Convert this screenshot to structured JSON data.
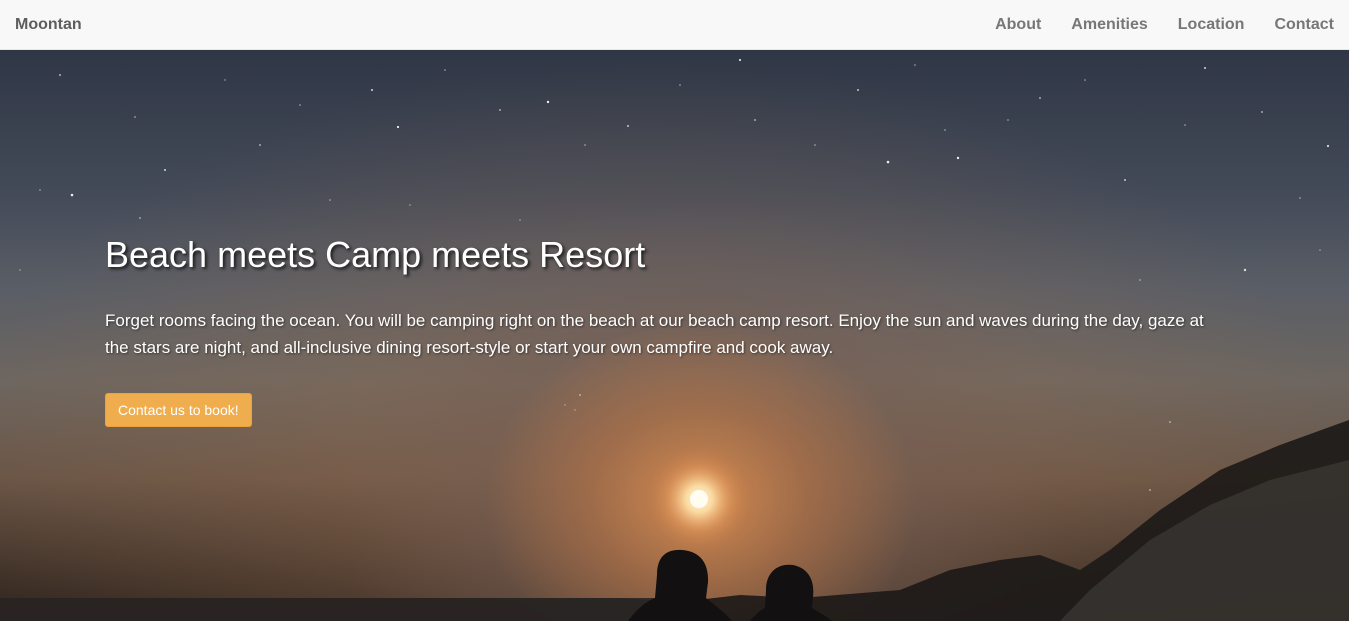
{
  "nav": {
    "brand": "Moontan",
    "links": [
      "About",
      "Amenities",
      "Location",
      "Contact"
    ]
  },
  "hero": {
    "title": "Beach meets Camp meets Resort",
    "text": "Forget rooms facing the ocean. You will be camping right on the beach at our beach camp resort. Enjoy the sun and waves during the day, gaze at the stars are night, and all-inclusive dining resort-style or start your own campfire and cook away.",
    "button_label": "Contact us to book!"
  },
  "colors": {
    "navbar_bg": "#f8f8f8",
    "nav_text": "#777777",
    "brand_text": "#5e5e5e",
    "button_bg": "#f0ad4e",
    "hero_text": "#ffffff"
  }
}
